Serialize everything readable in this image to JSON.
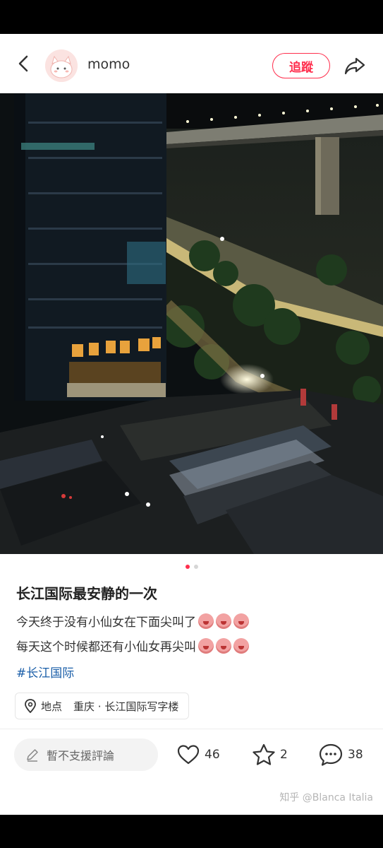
{
  "header": {
    "username": "momo",
    "follow_label": "追蹤"
  },
  "post": {
    "title": "长江国际最安静的一次",
    "lines": [
      "今天终于没有小仙女在下面尖叫了",
      "每天这个时候都还有小仙女再尖叫"
    ],
    "hashtag": "#长江国际",
    "location_label": "地点",
    "location_value": "重庆 · 长江国际写字楼",
    "image_count": 2,
    "current_image": 1
  },
  "actions": {
    "comment_placeholder": "暫不支援評論",
    "likes": "46",
    "favorites": "2",
    "comments": "38"
  },
  "watermark": "知乎 @Blanca Italia",
  "colors": {
    "accent": "#ff2e4d",
    "hashtag": "#1a5ea8"
  }
}
